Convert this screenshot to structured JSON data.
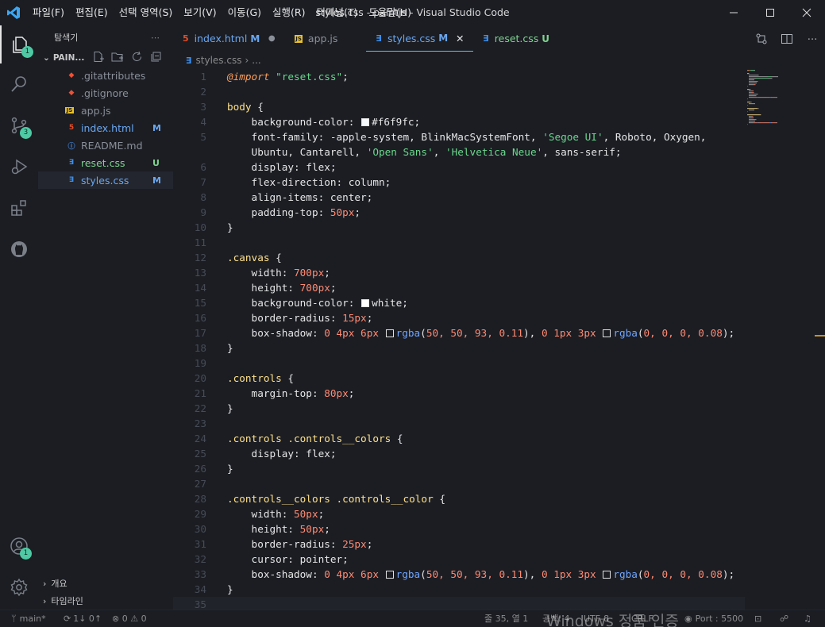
{
  "titlebar": {
    "menu": [
      "파일(F)",
      "편집(E)",
      "선택 영역(S)",
      "보기(V)",
      "이동(G)",
      "실행(R)",
      "터미널(T)",
      "도움말(H)"
    ],
    "title": "styles.css - paintjs - Visual Studio Code"
  },
  "activity": {
    "badges": {
      "explorer": "1",
      "scm": "3",
      "accounts": "1"
    }
  },
  "sidebar": {
    "title": "탐색기",
    "root": "PAIN...",
    "files": [
      {
        "name": ".gitattributes",
        "icon": "git-icon",
        "color": "#f05133",
        "status": ""
      },
      {
        "name": ".gitignore",
        "icon": "git-icon",
        "color": "#f05133",
        "status": ""
      },
      {
        "name": "app.js",
        "icon": "js-icon",
        "color": "#e8c02c",
        "status": ""
      },
      {
        "name": "index.html",
        "icon": "html-icon",
        "color": "#e44d26",
        "status": "M"
      },
      {
        "name": "README.md",
        "icon": "info-icon",
        "color": "#4a8fe8",
        "status": ""
      },
      {
        "name": "reset.css",
        "icon": "css-icon",
        "color": "#3d8eea",
        "status": "U"
      },
      {
        "name": "styles.css",
        "icon": "css-icon",
        "color": "#3d8eea",
        "status": "M"
      }
    ],
    "footer": [
      "개요",
      "타임라인"
    ]
  },
  "tabs": [
    {
      "name": "index.html",
      "status": "M",
      "icon": "html-icon",
      "active": false
    },
    {
      "name": "app.js",
      "status": "",
      "icon": "js-icon",
      "active": false
    },
    {
      "name": "styles.css",
      "status": "M",
      "icon": "css-icon",
      "active": true
    },
    {
      "name": "reset.css",
      "status": "U",
      "icon": "css-icon",
      "active": false
    }
  ],
  "breadcrumb": {
    "file": "styles.css",
    "rest": "..."
  },
  "code": [
    [
      [
        "@import",
        "at"
      ],
      [
        " ",
        ""
      ],
      [
        "\"reset.css\"",
        "s"
      ],
      [
        ";",
        ""
      ]
    ],
    [],
    [
      [
        "body",
        "k"
      ],
      [
        " {",
        ""
      ]
    ],
    [
      [
        "    background-color: ",
        ""
      ],
      [
        "#f6f9fc",
        "sw:#f6f9fc"
      ],
      [
        ";",
        ""
      ]
    ],
    [
      [
        "    font-family: -apple-system, BlinkMacSystemFont, ",
        ""
      ],
      [
        "'Segoe UI'",
        "s"
      ],
      [
        ", Roboto, Oxygen,",
        ""
      ]
    ],
    [
      [
        "    Ubuntu, Cantarell, ",
        ""
      ],
      [
        "'Open Sans'",
        "s"
      ],
      [
        ", ",
        ""
      ],
      [
        "'Helvetica Neue'",
        "s"
      ],
      [
        ", sans-serif;",
        ""
      ]
    ],
    [
      [
        "    display: flex;",
        ""
      ]
    ],
    [
      [
        "    flex-direction: column;",
        ""
      ]
    ],
    [
      [
        "    align-items: center;",
        ""
      ]
    ],
    [
      [
        "    padding-top: ",
        ""
      ],
      [
        "50px",
        "v"
      ],
      [
        ";",
        ""
      ]
    ],
    [
      [
        "}",
        ""
      ]
    ],
    [],
    [
      [
        ".canvas",
        "k"
      ],
      [
        " {",
        ""
      ]
    ],
    [
      [
        "    width: ",
        ""
      ],
      [
        "700px",
        "v"
      ],
      [
        ";",
        ""
      ]
    ],
    [
      [
        "    height: ",
        ""
      ],
      [
        "700px",
        "v"
      ],
      [
        ";",
        ""
      ]
    ],
    [
      [
        "    background-color: ",
        ""
      ],
      [
        "white",
        "sw:#ffffff"
      ],
      [
        ";",
        ""
      ]
    ],
    [
      [
        "    border-radius: ",
        ""
      ],
      [
        "15px",
        "v"
      ],
      [
        ";",
        ""
      ]
    ],
    [
      [
        "    box-shadow: ",
        ""
      ],
      [
        "0 4px 6px ",
        "v"
      ],
      [
        "rgba",
        "swf:#32325d"
      ],
      [
        "(",
        ""
      ],
      [
        "50, 50, 93, 0.11",
        "v"
      ],
      [
        "), ",
        ""
      ],
      [
        "0 1px 3px ",
        "v"
      ],
      [
        "rgba",
        "swf:#000000"
      ],
      [
        "(",
        ""
      ],
      [
        "0, 0, 0, 0.08",
        "v"
      ],
      [
        ");",
        ""
      ]
    ],
    [
      [
        "}",
        ""
      ]
    ],
    [],
    [
      [
        ".controls",
        "k"
      ],
      [
        " {",
        ""
      ]
    ],
    [
      [
        "    margin-top: ",
        ""
      ],
      [
        "80px",
        "v"
      ],
      [
        ";",
        ""
      ]
    ],
    [
      [
        "}",
        ""
      ]
    ],
    [],
    [
      [
        ".controls .controls__colors",
        "k"
      ],
      [
        " {",
        ""
      ]
    ],
    [
      [
        "    display: flex;",
        ""
      ]
    ],
    [
      [
        "}",
        ""
      ]
    ],
    [],
    [
      [
        ".controls__colors .controls__color",
        "k"
      ],
      [
        " {",
        ""
      ]
    ],
    [
      [
        "    width: ",
        ""
      ],
      [
        "50px",
        "v"
      ],
      [
        ";",
        ""
      ]
    ],
    [
      [
        "    height: ",
        ""
      ],
      [
        "50px",
        "v"
      ],
      [
        ";",
        ""
      ]
    ],
    [
      [
        "    border-radius: ",
        ""
      ],
      [
        "25px",
        "v"
      ],
      [
        ";",
        ""
      ]
    ],
    [
      [
        "    cursor: pointer;",
        ""
      ]
    ],
    [
      [
        "    box-shadow: ",
        ""
      ],
      [
        "0 4px 6px ",
        "v"
      ],
      [
        "rgba",
        "swf:#32325d"
      ],
      [
        "(",
        ""
      ],
      [
        "50, 50, 93, 0.11",
        "v"
      ],
      [
        "), ",
        ""
      ],
      [
        "0 1px 3px ",
        "v"
      ],
      [
        "rgba",
        "swf:#000000"
      ],
      [
        "(",
        ""
      ],
      [
        "0, 0, 0, 0.08",
        "v"
      ],
      [
        ");",
        ""
      ]
    ],
    [
      [
        "}",
        ""
      ]
    ],
    []
  ],
  "line_numbers": [
    "1",
    "2",
    "3",
    "4",
    "5",
    "",
    "6",
    "7",
    "8",
    "9",
    "10",
    "11",
    "12",
    "13",
    "14",
    "15",
    "16",
    "17",
    "18",
    "19",
    "20",
    "21",
    "22",
    "23",
    "24",
    "25",
    "26",
    "27",
    "28",
    "29",
    "30",
    "31",
    "32",
    "33",
    "34",
    "35"
  ],
  "cursor_line": 35,
  "status": {
    "branch": "main*",
    "sync": "1↓ 0↑",
    "errors": "0",
    "warnings": "0",
    "position": "줄 35, 열 1",
    "spaces": "공백: 4",
    "encoding": "UTF-8",
    "eol": "CRLF",
    "port": "Port : 5500"
  },
  "watermark": "Windows 정품 인증"
}
